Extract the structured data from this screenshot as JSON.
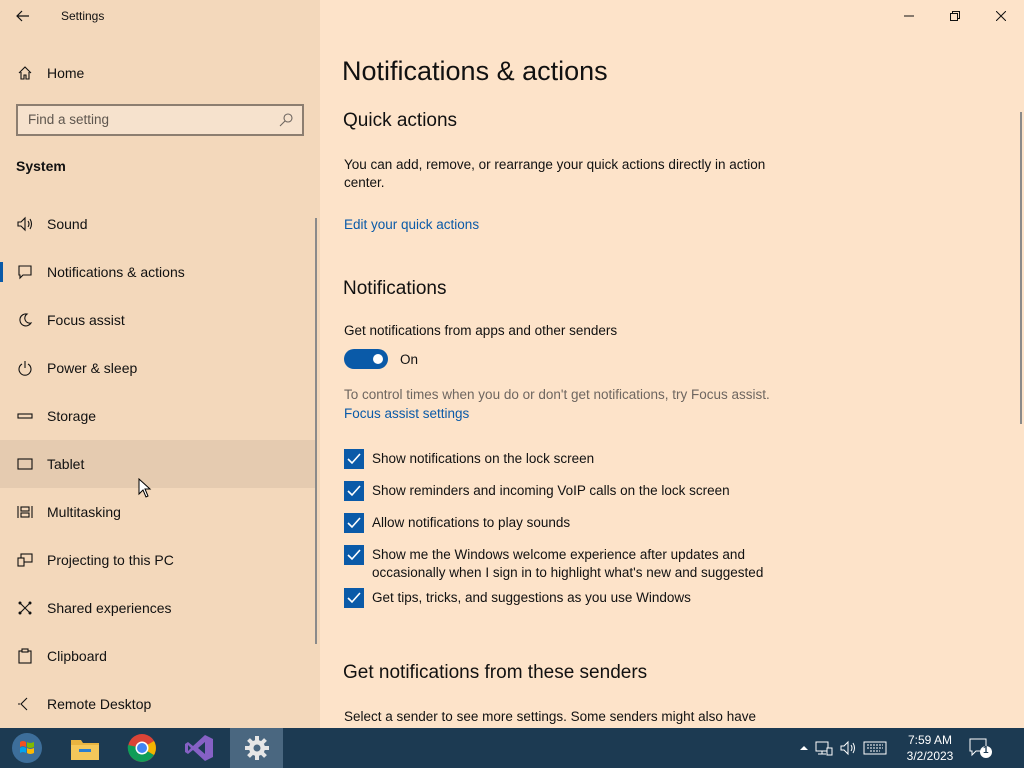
{
  "window": {
    "title": "Settings",
    "controls": {
      "minimize": "minimize",
      "restore": "restore",
      "close": "close"
    }
  },
  "sidebar": {
    "home_label": "Home",
    "search_placeholder": "Find a setting",
    "section_label": "System",
    "items": [
      {
        "label": "Sound",
        "icon": "speaker-icon"
      },
      {
        "label": "Notifications & actions",
        "icon": "notification-icon",
        "active": true
      },
      {
        "label": "Focus assist",
        "icon": "moon-icon"
      },
      {
        "label": "Power & sleep",
        "icon": "power-icon"
      },
      {
        "label": "Storage",
        "icon": "storage-icon"
      },
      {
        "label": "Tablet",
        "icon": "tablet-icon",
        "hover": true
      },
      {
        "label": "Multitasking",
        "icon": "multitasking-icon"
      },
      {
        "label": "Projecting to this PC",
        "icon": "projecting-icon"
      },
      {
        "label": "Shared experiences",
        "icon": "shared-icon"
      },
      {
        "label": "Clipboard",
        "icon": "clipboard-icon"
      },
      {
        "label": "Remote Desktop",
        "icon": "remote-desktop-icon"
      }
    ]
  },
  "main": {
    "page_title": "Notifications & actions",
    "quick_actions": {
      "heading": "Quick actions",
      "description": "You can add, remove, or rearrange your quick actions directly in action center.",
      "link": "Edit your quick actions"
    },
    "notifications": {
      "heading": "Notifications",
      "get_label": "Get notifications from apps and other senders",
      "toggle_state": "On",
      "focus_text": "To control times when you do or don't get notifications, try Focus assist.",
      "focus_link": "Focus assist settings",
      "checkboxes": [
        "Show notifications on the lock screen",
        "Show reminders and incoming VoIP calls on the lock screen",
        "Allow notifications to play sounds",
        "Show me the Windows welcome experience after updates and occasionally when I sign in to highlight what's new and suggested",
        "Get tips, tricks, and suggestions as you use Windows"
      ]
    },
    "senders": {
      "heading": "Get notifications from these senders",
      "description": "Select a sender to see more settings. Some senders might also have"
    }
  },
  "taskbar": {
    "time": "7:59 AM",
    "date": "3/2/2023",
    "notification_count": "1",
    "apps": [
      "start-button",
      "file-explorer",
      "chrome",
      "visual-studio",
      "settings"
    ]
  },
  "colors": {
    "accent": "#0a5aa8",
    "background": "#fde3c9",
    "sidebar": "#f3d8bb",
    "taskbar": "#1c3a52"
  }
}
